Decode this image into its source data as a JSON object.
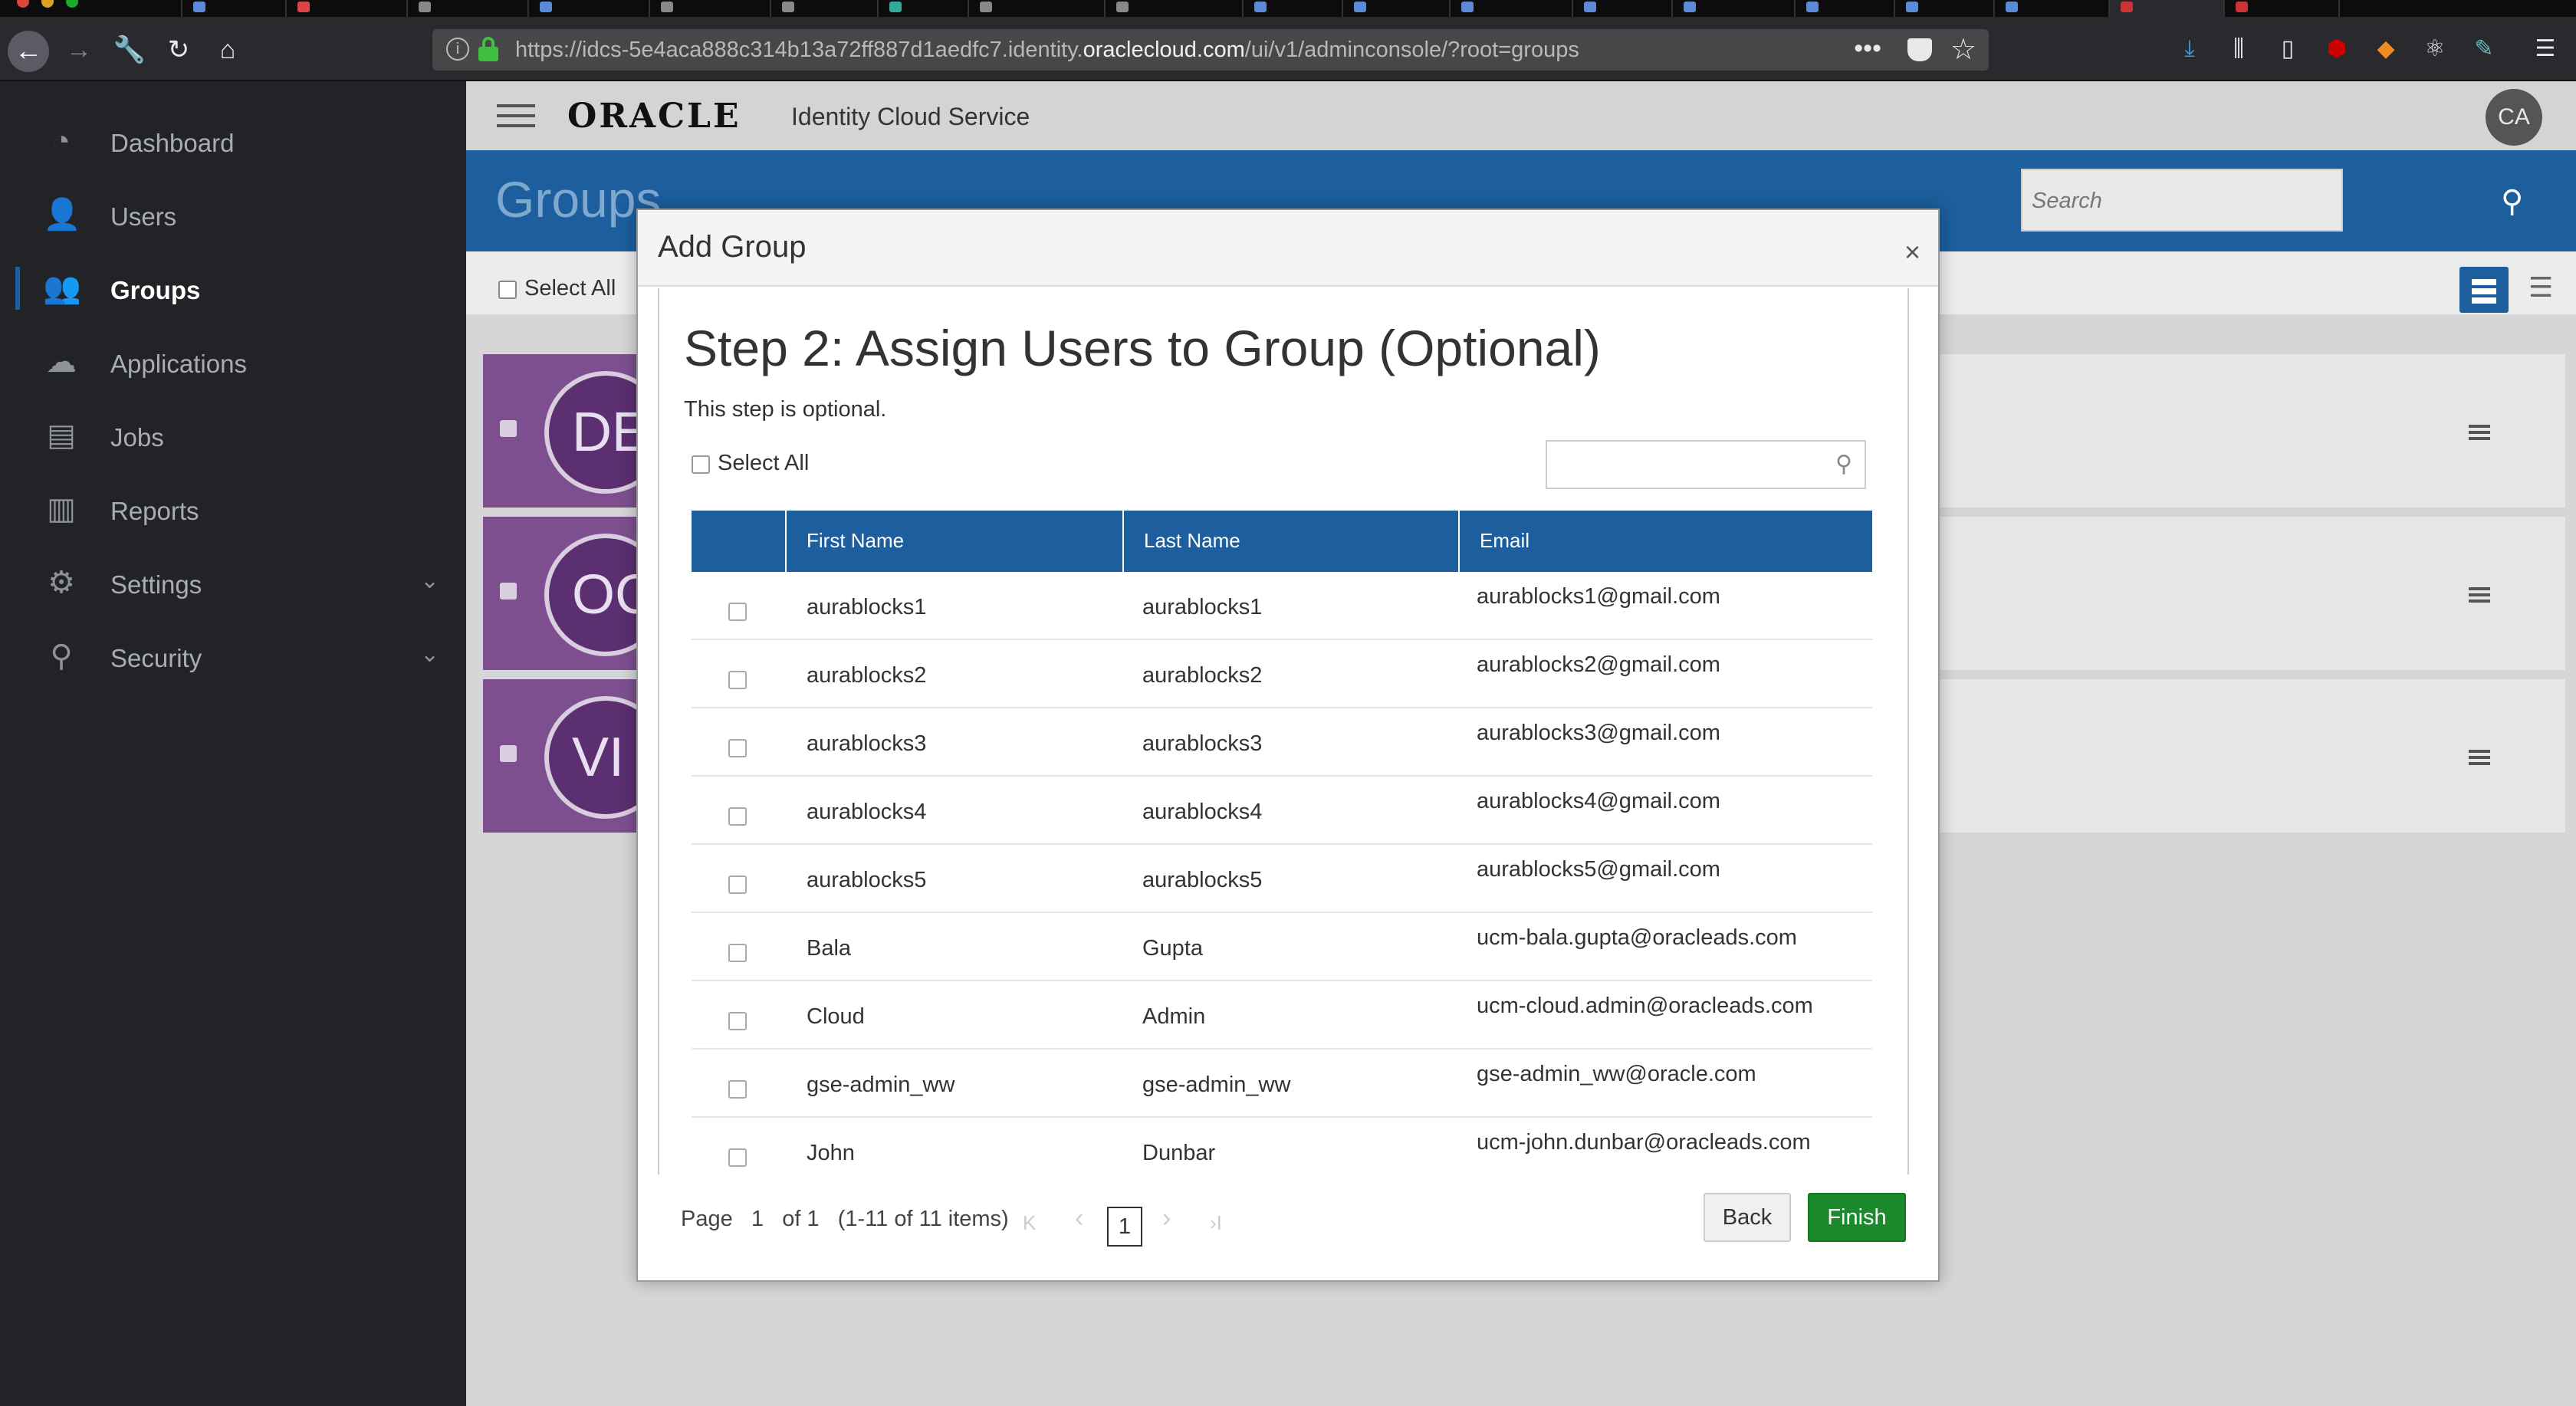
{
  "browser": {
    "url_pre": "https://idcs-5e4aca888c314b13a72ff887d1aedfc7.identity.",
    "url_domain": "oraclecloud.com",
    "url_post": "/ui/v1/adminconsole/?root=groups",
    "menu_dots": "•••"
  },
  "sidebar": {
    "items": [
      {
        "label": "Dashboard"
      },
      {
        "label": "Users"
      },
      {
        "label": "Groups"
      },
      {
        "label": "Applications"
      },
      {
        "label": "Jobs"
      },
      {
        "label": "Reports"
      },
      {
        "label": "Settings"
      },
      {
        "label": "Security"
      }
    ]
  },
  "header": {
    "logo": "ORACLE",
    "product": "Identity Cloud Service",
    "avatar": "CA"
  },
  "page": {
    "title": "Groups",
    "search_placeholder": "Search",
    "select_all": "Select All",
    "groups": [
      {
        "initials": "DE"
      },
      {
        "initials": "OC"
      },
      {
        "initials": "VI"
      }
    ]
  },
  "modal": {
    "title": "Add Group",
    "close": "×",
    "step_title": "Step 2: Assign Users to Group (Optional)",
    "step_sub": "This step is optional.",
    "select_all": "Select All",
    "columns": [
      "First Name",
      "Last Name",
      "Email"
    ],
    "rows": [
      {
        "first": "aurablocks1",
        "last": "aurablocks1",
        "email": "aurablocks1@gmail.com"
      },
      {
        "first": "aurablocks2",
        "last": "aurablocks2",
        "email": "aurablocks2@gmail.com"
      },
      {
        "first": "aurablocks3",
        "last": "aurablocks3",
        "email": "aurablocks3@gmail.com"
      },
      {
        "first": "aurablocks4",
        "last": "aurablocks4",
        "email": "aurablocks4@gmail.com"
      },
      {
        "first": "aurablocks5",
        "last": "aurablocks5",
        "email": "aurablocks5@gmail.com"
      },
      {
        "first": "Bala",
        "last": "Gupta",
        "email": "ucm-bala.gupta@oracleads.com"
      },
      {
        "first": "Cloud",
        "last": "Admin",
        "email": "ucm-cloud.admin@oracleads.com"
      },
      {
        "first": "gse-admin_ww",
        "last": "gse-admin_ww",
        "email": "gse-admin_ww@oracle.com"
      },
      {
        "first": "John",
        "last": "Dunbar",
        "email": "ucm-john.dunbar@oracleads.com"
      }
    ],
    "pager": {
      "page_label": "Page",
      "page": "1",
      "of_label": "of 1",
      "items": "(1-11 of 11 items)",
      "current": "1",
      "first": "K",
      "prev": "‹",
      "next": "›",
      "last": "›I"
    },
    "back": "Back",
    "finish": "Finish"
  }
}
